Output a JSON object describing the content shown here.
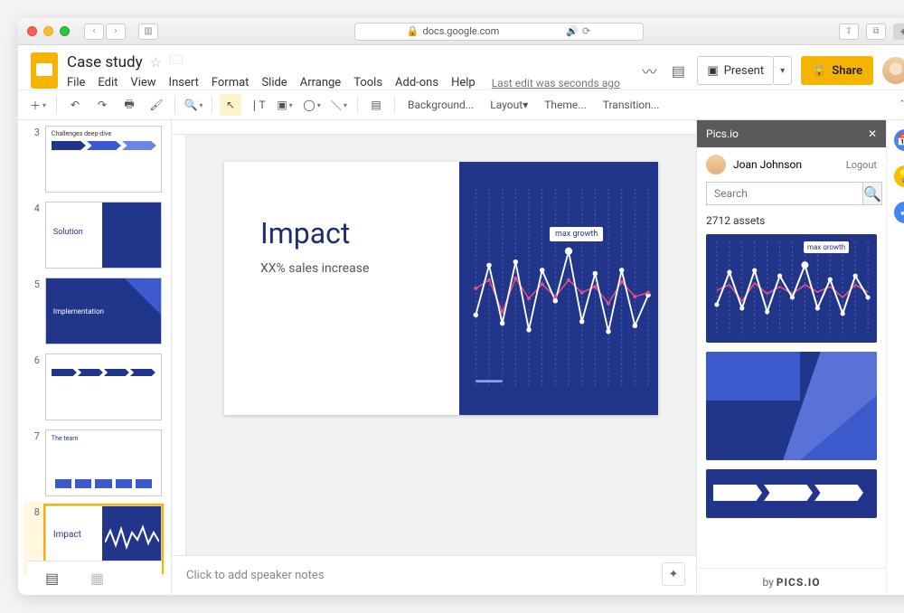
{
  "browser": {
    "url": "docs.google.com"
  },
  "doc": {
    "title": "Case study",
    "last_edit": "Last edit was seconds ago"
  },
  "menu": {
    "file": "File",
    "edit": "Edit",
    "view": "View",
    "insert": "Insert",
    "format": "Format",
    "slide": "Slide",
    "arrange": "Arrange",
    "tools": "Tools",
    "addons": "Add-ons",
    "help": "Help"
  },
  "header": {
    "present": "Present",
    "share": "Share"
  },
  "toolbar": {
    "background": "Background...",
    "layout": "Layout",
    "theme": "Theme...",
    "transition": "Transition..."
  },
  "thumbs": [
    {
      "num": "3",
      "caption": "Challenges deep-dive"
    },
    {
      "num": "4",
      "caption": "Solution"
    },
    {
      "num": "5",
      "caption": "Implementation"
    },
    {
      "num": "6",
      "caption": ""
    },
    {
      "num": "7",
      "caption": "The team"
    },
    {
      "num": "8",
      "caption": "Impact"
    }
  ],
  "slide": {
    "title": "Impact",
    "subtitle": "XX% sales increase",
    "chart_label": "max growth"
  },
  "speaker": {
    "placeholder": "Click to add speaker notes"
  },
  "picsio": {
    "title": "Pics.io",
    "user": "Joan Johnson",
    "logout": "Logout",
    "search_placeholder": "Search",
    "asset_count": "2712 assets",
    "asset_label": "max growth",
    "by": "by",
    "brand": "PICS.IO"
  },
  "chart_data": {
    "type": "line",
    "note": "values estimated from screenshot; two oscillating series over ~14 vertical gridlines",
    "x": [
      0,
      1,
      2,
      3,
      4,
      5,
      6,
      7,
      8,
      9,
      10,
      11,
      12,
      13
    ],
    "series": [
      {
        "name": "white",
        "values": [
          40,
          70,
          35,
          72,
          30,
          68,
          48,
          80,
          35,
          65,
          30,
          68,
          32,
          55
        ]
      },
      {
        "name": "magenta",
        "values": [
          55,
          60,
          38,
          62,
          45,
          58,
          46,
          60,
          50,
          55,
          44,
          58,
          46,
          50
        ]
      }
    ],
    "annotation": {
      "text": "max growth",
      "x": 7
    },
    "ylim": [
      0,
      100
    ]
  }
}
